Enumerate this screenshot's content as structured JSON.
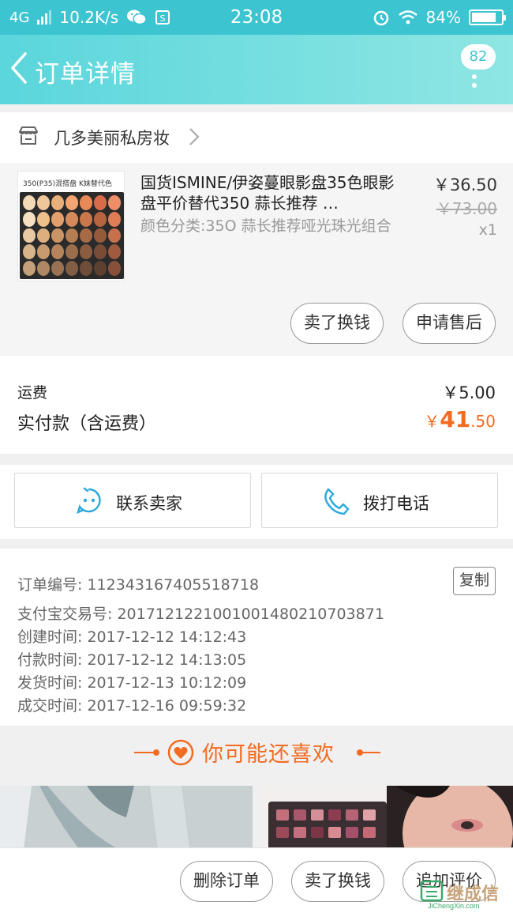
{
  "status_bar": {
    "network": "4G",
    "speed": "10.2K/s",
    "time": "23:08",
    "battery": "84%",
    "battery_level": 0.84
  },
  "nav": {
    "title": "订单详情",
    "badge": "82"
  },
  "shop": {
    "name": "几多美丽私房妆"
  },
  "product": {
    "thumb_label": "350(P35)混搭盘 K妹替代色",
    "title": "国货ISMINE/伊姿蔓眼影盘35色眼影盘平价替代350 蒜长推荐 …",
    "spec": "颜色分类:35O 蒜长推荐哑光珠光组合",
    "price": "￥36.50",
    "original_price": "￥73.00",
    "quantity": "x1",
    "actions": [
      "卖了换钱",
      "申请售后"
    ]
  },
  "fees": {
    "shipping_label": "运费",
    "shipping_value": "￥5.00",
    "total_label": "实付款（含运费）",
    "total_currency": "￥",
    "total_int": "41",
    "total_dec": ".50"
  },
  "contact": {
    "seller": "联系卖家",
    "call": "拨打电话"
  },
  "order_info": {
    "copy": "复制",
    "rows": [
      "订单编号: 112343167405518718",
      "支付宝交易号: 2017121221001001480210703871",
      "创建时间: 2017-12-12 14:12:43",
      "付款时间: 2017-12-12 14:13:05",
      "发货时间: 2017-12-13 10:12:09",
      "成交时间: 2017-12-16 09:59:32"
    ]
  },
  "recommend": {
    "title": "你可能还喜欢"
  },
  "bottom_actions": [
    "删除订单",
    "卖了换钱",
    "追加评价"
  ],
  "watermark": {
    "text": "继成信",
    "sub": "JiChengXin.com"
  },
  "colors": {
    "teal": "#3cc4d0",
    "accent": "#f36b21",
    "contact_blue": "#2eaadc"
  }
}
